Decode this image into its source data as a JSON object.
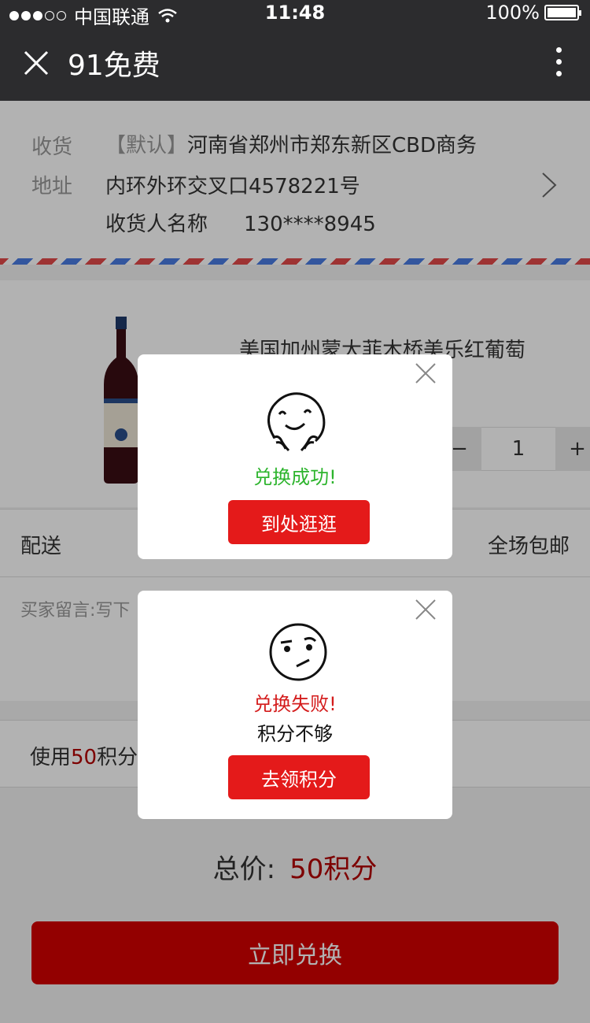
{
  "status_bar": {
    "carrier": "中国联通",
    "time": "11:48",
    "battery": "100%"
  },
  "nav": {
    "title": "91免费"
  },
  "address": {
    "label_line1": "收货",
    "label_line2": "地址",
    "tag": "【默认】",
    "line1": "河南省郑州市郑东新区CBD商务",
    "line2": "内环外环交叉口4578221号",
    "receiver": "收货人名称",
    "phone": "130****8945"
  },
  "product": {
    "name": "美国加州蒙大菲木桥美乐红葡萄",
    "quantity": "1",
    "minus": "−",
    "plus": "+"
  },
  "delivery": {
    "label": "配送",
    "value": "全场包邮"
  },
  "message": {
    "placeholder": "买家留言:写下"
  },
  "points": {
    "prefix": "使用",
    "amount": "50",
    "suffix": "积分"
  },
  "total": {
    "label": "总价:",
    "amount": "50积分"
  },
  "submit": {
    "label": "立即兑换"
  },
  "dialog_success": {
    "title": "兑换成功!",
    "button": "到处逛逛",
    "title_color": "#2db42d"
  },
  "dialog_fail": {
    "title": "兑换失败!",
    "subtitle": "积分不够",
    "button": "去领积分",
    "title_color": "#d41c1c"
  },
  "colors": {
    "accent": "#d30000",
    "nav_bg": "#2c2c2e"
  }
}
